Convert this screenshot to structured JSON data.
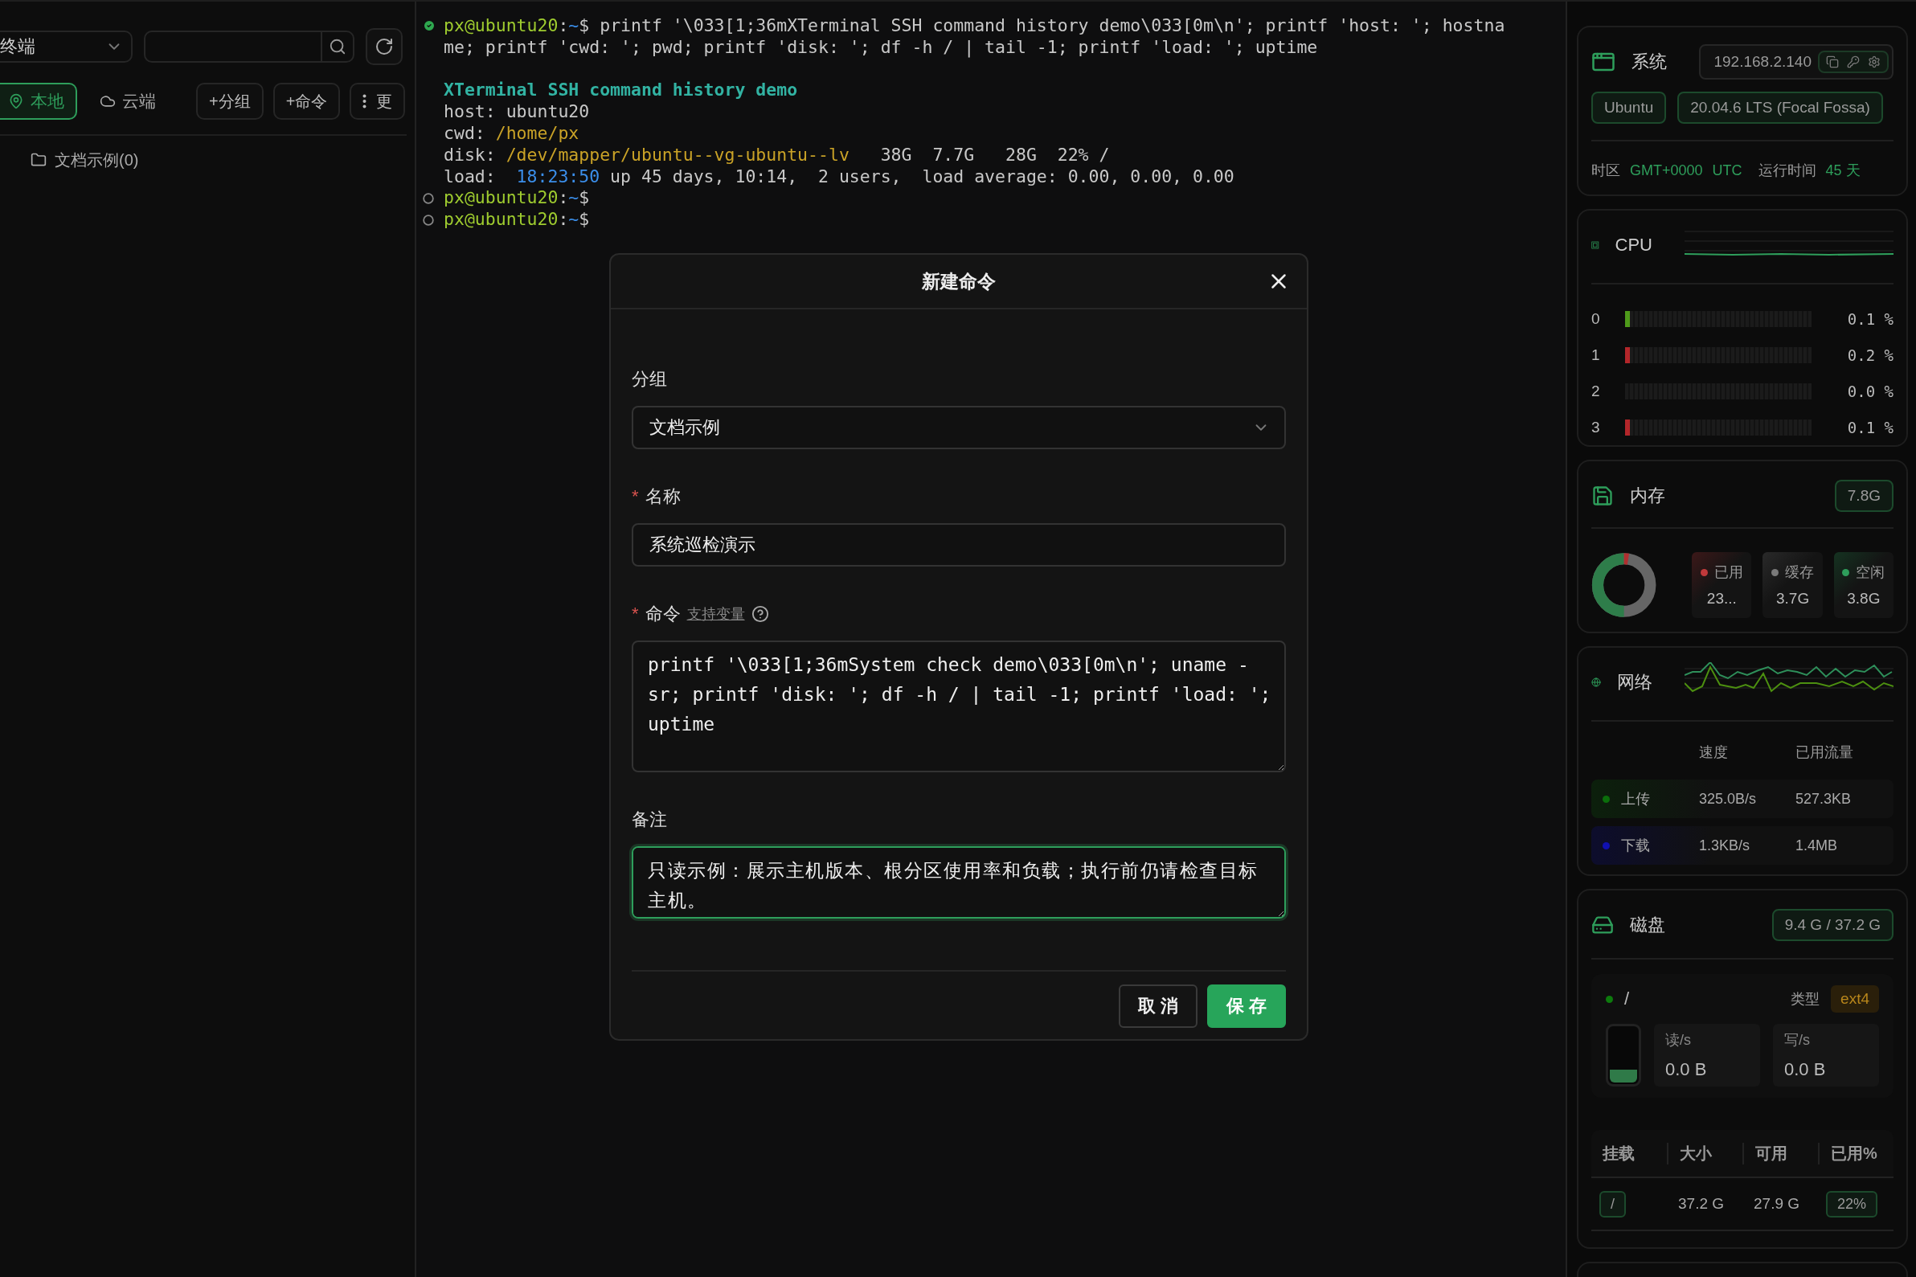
{
  "sidebar": {
    "scope_select": {
      "value": "终端"
    },
    "source_tabs": [
      {
        "label": "本地",
        "selected": true
      },
      {
        "label": "云端",
        "selected": false
      }
    ],
    "actions": [
      "+分组",
      "+命令"
    ],
    "more_button": "更",
    "tree": [
      {
        "label": "文档示例(0)"
      }
    ]
  },
  "terminal": {
    "lines": [
      {
        "kind": "command_ok",
        "segments": [
          {
            "kind": "user",
            "text": "px@ubuntu20"
          },
          {
            "kind": "text",
            "text": ":"
          },
          {
            "kind": "dir",
            "text": "~"
          },
          {
            "kind": "text",
            "text": "$ printf '\\033[1;36mXTerminal SSH command history demo\\033[0m\\n'; printf 'host: '; hostna"
          }
        ]
      },
      {
        "kind": "output",
        "segments": [
          {
            "kind": "text",
            "text": "me; printf 'cwd: '; pwd; printf 'disk: '; df -h / | tail -1; printf 'load: '; uptime"
          }
        ]
      },
      {
        "kind": "blank"
      },
      {
        "kind": "output",
        "segments": [
          {
            "kind": "title",
            "text": "XTerminal SSH command history demo"
          }
        ]
      },
      {
        "kind": "output",
        "segments": [
          {
            "kind": "text",
            "text": "host: ubuntu20"
          }
        ]
      },
      {
        "kind": "output",
        "segments": [
          {
            "kind": "text",
            "text": "cwd: "
          },
          {
            "kind": "file",
            "text": "/home/px"
          }
        ]
      },
      {
        "kind": "output",
        "segments": [
          {
            "kind": "text",
            "text": "disk: "
          },
          {
            "kind": "file",
            "text": "/dev/mapper/ubuntu--vg-ubuntu--lv"
          },
          {
            "kind": "text",
            "text": "   38G  7.7G   28G  22% /"
          }
        ]
      },
      {
        "kind": "output",
        "segments": [
          {
            "kind": "text",
            "text": "load:  "
          },
          {
            "kind": "dir",
            "text": "18:23:50"
          },
          {
            "kind": "text",
            "text": " up 45 days, 10:14,  2 users,  load average: 0.00, 0.00, 0.00"
          }
        ]
      },
      {
        "kind": "prompt",
        "segments": [
          {
            "kind": "user",
            "text": "px@ubuntu20"
          },
          {
            "kind": "text",
            "text": ":"
          },
          {
            "kind": "dir",
            "text": "~"
          },
          {
            "kind": "text",
            "text": "$"
          }
        ]
      },
      {
        "kind": "prompt",
        "segments": [
          {
            "kind": "user",
            "text": "px@ubuntu20"
          },
          {
            "kind": "text",
            "text": ":"
          },
          {
            "kind": "dir",
            "text": "~"
          },
          {
            "kind": "text",
            "text": "$"
          }
        ]
      }
    ]
  },
  "dialog": {
    "title": "新建命令",
    "fields": [
      {
        "kind": "select",
        "label": "分组",
        "focused": false,
        "value": "文档示例"
      },
      {
        "kind": "input",
        "required_mark": "*",
        "label": "名称",
        "focused": false,
        "value": "系统巡检演示"
      },
      {
        "kind": "textarea",
        "required_mark": "*",
        "label": "命令",
        "focused": false,
        "mono": true,
        "link": "支持变量",
        "value": "printf '\\033[1;36mSystem check demo\\033[0m\\n'; uname -sr; printf 'disk: '; df -h / | tail -1; printf 'load: '; uptime"
      },
      {
        "kind": "textarea",
        "label": "备注",
        "focused": true,
        "mono": false,
        "value": "只读示例：展示主机版本、根分区使用率和负载；执行前仍请检查目标主机。"
      }
    ],
    "buttons": [
      {
        "kind": "secondary",
        "label": "取 消"
      },
      {
        "kind": "primary",
        "label": "保 存"
      }
    ]
  },
  "monitor": {
    "system": {
      "title": "系统",
      "ip": "192.168.2.140",
      "os": "Ubuntu",
      "version": "20.04.6 LTS (Focal Fossa)",
      "timezone_label": "时区",
      "timezone": "GMT+0000",
      "zone": "UTC",
      "uptime_label": "运行时间",
      "uptime": "45 天"
    },
    "cpu": {
      "title": "CPU",
      "cores": [
        {
          "label": "0",
          "level": 0.001,
          "reading": "0.1 %",
          "color": "#4e9a1a"
        },
        {
          "label": "1",
          "level": 0.002,
          "reading": "0.2 %",
          "color": "#b3262a"
        },
        {
          "label": "2",
          "level": 0,
          "reading": "0.0 %"
        },
        {
          "label": "3",
          "level": 0.001,
          "reading": "0.1 %",
          "color": "#b3262a"
        }
      ]
    },
    "memory": {
      "title": "内存",
      "total": "7.8G",
      "stats": [
        {
          "label": "已用",
          "value": "23...",
          "color": "#c0393b"
        },
        {
          "label": "缓存",
          "value": "3.7G",
          "color": "#7a7a7a"
        },
        {
          "label": "空闲",
          "value": "3.8G",
          "color": "#2e9e5b"
        }
      ]
    },
    "network": {
      "title": "网络",
      "columns": [
        "速度",
        "已用流量"
      ],
      "rows": [
        {
          "label": "上传",
          "speed": "325.0B/s",
          "used": "527.3KB",
          "color": "#0b6e0b"
        },
        {
          "label": "下载",
          "speed": "1.3KB/s",
          "used": "1.4MB",
          "color": "#1010b0"
        }
      ]
    },
    "disk": {
      "title": "磁盘",
      "usage": "9.4 G / 37.2 G",
      "mount": {
        "path": "/",
        "type_label": "类型",
        "type": "ext4",
        "level": 0.22,
        "read_label": "读/s",
        "read": "0.0 B",
        "write_label": "写/s",
        "write": "0.0 B"
      },
      "table": {
        "columns": [
          "挂载",
          "大小",
          "可用",
          "已用%"
        ],
        "rows": [
          {
            "mount": "/",
            "size": "37.2 G",
            "available": "27.9 G",
            "used": "22%"
          }
        ]
      }
    }
  }
}
